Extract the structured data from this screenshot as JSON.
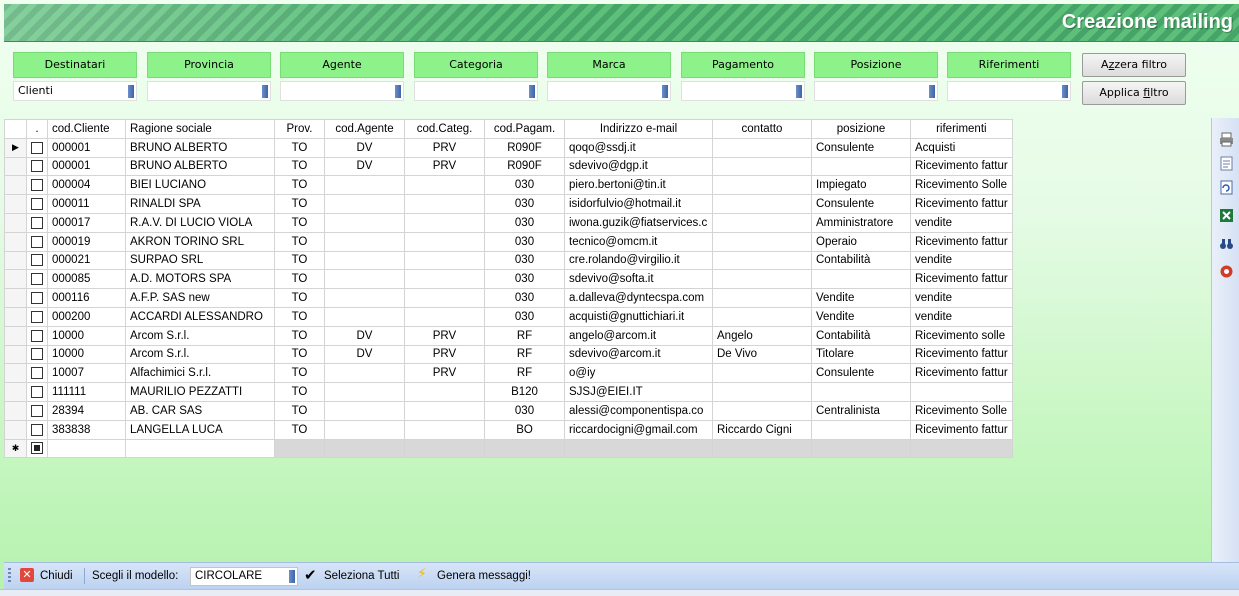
{
  "header": {
    "title": "Creazione mailing"
  },
  "filters": [
    {
      "label": "Destinatari",
      "value": "Clienti"
    },
    {
      "label": "Provincia",
      "value": ""
    },
    {
      "label": "Agente",
      "value": ""
    },
    {
      "label": "Categoria",
      "value": ""
    },
    {
      "label": "Marca",
      "value": ""
    },
    {
      "label": "Pagamento",
      "value": ""
    },
    {
      "label": "Posizione",
      "value": ""
    },
    {
      "label": "Riferimenti",
      "value": ""
    }
  ],
  "buttons": {
    "reset_pre": "A",
    "reset_key": "z",
    "reset_post": "zera filtro",
    "apply_pre": "Applica ",
    "apply_key": "f",
    "apply_post": "iltro"
  },
  "grid": {
    "columns": [
      ".",
      "cod.Cliente",
      "Ragione sociale",
      "Prov.",
      "cod.Agente",
      "cod.Categ.",
      "cod.Pagam.",
      "Indirizzo e-mail",
      "contatto",
      "posizione",
      "riferimenti"
    ],
    "rows": [
      {
        "code": "000001",
        "name": "BRUNO ALBERTO",
        "prov": "TO",
        "agent": "DV",
        "cat": "PRV",
        "pay": "R090F",
        "email": "qoqo@ssdj.it",
        "contact": "",
        "position": "Consulente",
        "ref": "Acquisti"
      },
      {
        "code": "000001",
        "name": "BRUNO ALBERTO",
        "prov": "TO",
        "agent": "DV",
        "cat": "PRV",
        "pay": "R090F",
        "email": "sdevivo@dgp.it",
        "contact": "",
        "position": "",
        "ref": "Ricevimento fattur"
      },
      {
        "code": "000004",
        "name": "BIEI LUCIANO",
        "prov": "TO",
        "agent": "",
        "cat": "",
        "pay": "030",
        "email": "piero.bertoni@tin.it",
        "contact": "",
        "position": "Impiegato",
        "ref": "Ricevimento Solle"
      },
      {
        "code": "000011",
        "name": "RINALDI SPA",
        "prov": "TO",
        "agent": "",
        "cat": "",
        "pay": "030",
        "email": "isidorfulvio@hotmail.it",
        "contact": "",
        "position": "Consulente",
        "ref": "Ricevimento fattur"
      },
      {
        "code": "000017",
        "name": "R.A.V. DI LUCIO VIOLA",
        "prov": "TO",
        "agent": "",
        "cat": "",
        "pay": "030",
        "email": "iwona.guzik@fiatservices.c",
        "contact": "",
        "position": "Amministratore",
        "ref": "vendite"
      },
      {
        "code": "000019",
        "name": "AKRON TORINO SRL",
        "prov": "TO",
        "agent": "",
        "cat": "",
        "pay": "030",
        "email": "tecnico@omcm.it",
        "contact": "",
        "position": "Operaio",
        "ref": "Ricevimento fattur"
      },
      {
        "code": "000021",
        "name": "SURPAO SRL",
        "prov": "TO",
        "agent": "",
        "cat": "",
        "pay": "030",
        "email": "cre.rolando@virgilio.it",
        "contact": "",
        "position": "Contabilità",
        "ref": "vendite"
      },
      {
        "code": "000085",
        "name": "A.D. MOTORS SPA",
        "prov": "TO",
        "agent": "",
        "cat": "",
        "pay": "030",
        "email": "sdevivo@softa.it",
        "contact": "",
        "position": "",
        "ref": "Ricevimento fattur"
      },
      {
        "code": "000116",
        "name": "A.F.P. SAS new",
        "prov": "TO",
        "agent": "",
        "cat": "",
        "pay": "030",
        "email": "a.dalleva@dyntecspa.com",
        "contact": "",
        "position": "Vendite",
        "ref": "vendite"
      },
      {
        "code": "000200",
        "name": "ACCARDI ALESSANDRO",
        "prov": "TO",
        "agent": "",
        "cat": "",
        "pay": "030",
        "email": "acquisti@gnuttichiari.it",
        "contact": "",
        "position": "Vendite",
        "ref": "vendite"
      },
      {
        "code": "10000",
        "name": "Arcom S.r.l.",
        "prov": "TO",
        "agent": "DV",
        "cat": "PRV",
        "pay": "RF",
        "email": "angelo@arcom.it",
        "contact": "Angelo",
        "position": "Contabilità",
        "ref": "Ricevimento solle"
      },
      {
        "code": "10000",
        "name": "Arcom S.r.l.",
        "prov": "TO",
        "agent": "DV",
        "cat": "PRV",
        "pay": "RF",
        "email": "sdevivo@arcom.it",
        "contact": "De Vivo",
        "position": "Titolare",
        "ref": "Ricevimento fattur"
      },
      {
        "code": "10007",
        "name": "Alfachimici S.r.l.",
        "prov": "TO",
        "agent": "",
        "cat": "PRV",
        "pay": "RF",
        "email": "o@iy",
        "contact": "",
        "position": "Consulente",
        "ref": "Ricevimento fattur"
      },
      {
        "code": "111111",
        "name": "MAURILIO PEZZATTI",
        "prov": "TO",
        "agent": "",
        "cat": "",
        "pay": "B120",
        "email": "SJSJ@EIEI.IT",
        "contact": "",
        "position": "",
        "ref": ""
      },
      {
        "code": "28394",
        "name": "AB. CAR SAS",
        "prov": "TO",
        "agent": "",
        "cat": "",
        "pay": "030",
        "email": "alessi@componentispa.co",
        "contact": "",
        "position": "Centralinista",
        "ref": "Ricevimento Solle"
      },
      {
        "code": "383838",
        "name": "LANGELLA LUCA",
        "prov": "TO",
        "agent": "",
        "cat": "",
        "pay": "BO",
        "email": "riccardocigni@gmail.com",
        "contact": "Riccardo Cigni",
        "position": "",
        "ref": "Ricevimento fattur"
      }
    ]
  },
  "toolbar": {
    "close_label": "Chiudi",
    "model_label": "Scegli il modello:",
    "model_value": "CIRCOLARE",
    "select_all_label": "Seleziona Tutti",
    "generate_label": "Genera messaggi!"
  },
  "icons": {
    "right_toolbar": [
      "printer-icon",
      "document-icon",
      "page-refresh-icon",
      "excel-icon",
      "binoculars-icon",
      "stop-icon"
    ],
    "bottom_toolbar": [
      "close-icon",
      "checkmark-icon",
      "lightning-icon"
    ]
  },
  "colors": {
    "header_stripe": "#47a468",
    "filter_label_bg": "#8ef28a",
    "toolbar_bg": "#c9dbf3",
    "close_icon": "#e2473b"
  }
}
